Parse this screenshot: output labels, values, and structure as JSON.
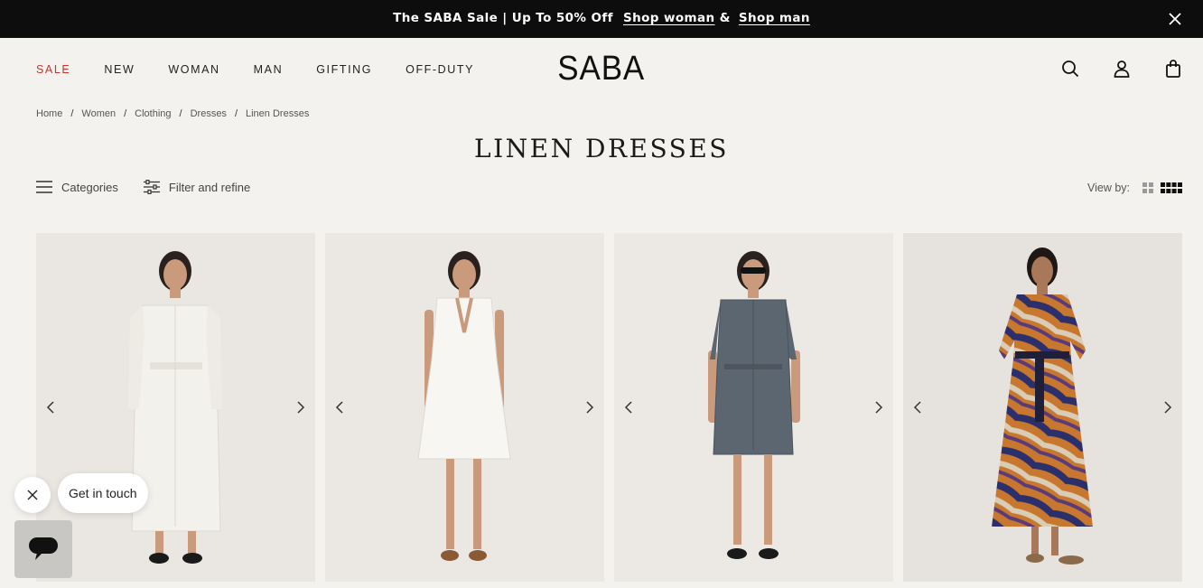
{
  "announcement": {
    "text": "The SABA Sale | Up To 50% Off",
    "link_woman": "Shop woman",
    "amp": "&",
    "link_man": "Shop man"
  },
  "nav": {
    "items": [
      "SALE",
      "NEW",
      "WOMAN",
      "MAN",
      "GIFTING",
      "OFF-DUTY"
    ]
  },
  "logo": "SABA",
  "header_icons": [
    "search-icon",
    "account-icon",
    "bag-icon"
  ],
  "breadcrumb": [
    "Home",
    "Women",
    "Clothing",
    "Dresses",
    "Linen Dresses"
  ],
  "breadcrumb_sep": "/",
  "page_title": "LINEN DRESSES",
  "toolbar": {
    "categories_label": "Categories",
    "filter_label": "Filter and refine",
    "view_by_label": "View by:"
  },
  "products": [
    {
      "dress_color": "#f3f1ec",
      "background": "#eae7e2",
      "shoe_color": "#1a1a1a"
    },
    {
      "dress_color": "#f7f6f2",
      "background": "#ebe7e3",
      "shoe_color": "#8a5a35"
    },
    {
      "dress_color": "#5c6670",
      "background": "#ece9e5",
      "shoe_color": "#1a1a1a"
    },
    {
      "dress_color": "pattern",
      "background": "#e6e3df",
      "shoe_color": "#8a6a4a"
    }
  ],
  "chat": {
    "bubble_label": "Get in touch"
  },
  "colors": {
    "sale_accent": "#c8342b",
    "announcement_bg": "#0d0d0d",
    "page_bg": "#f4f2ef"
  }
}
